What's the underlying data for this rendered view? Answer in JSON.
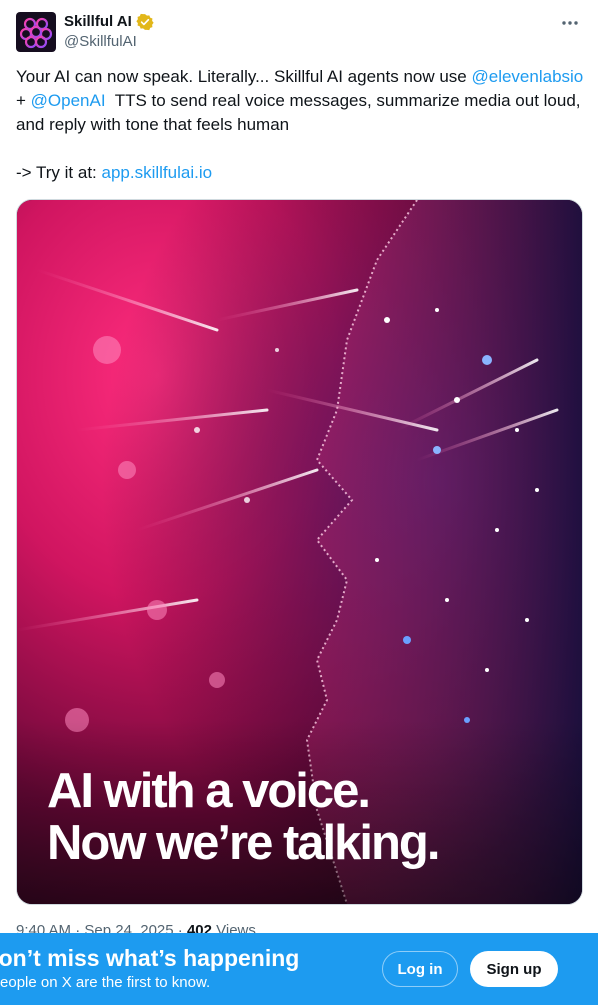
{
  "author": {
    "display_name": "Skillful AI",
    "handle": "@SkillfulAI",
    "verified": true
  },
  "tweet": {
    "text_part1": "Your AI can now speak. Literally... Skillful AI agents now use ",
    "mention1": "@elevenlabsio",
    "text_part2": "  + ",
    "mention2": "@OpenAI",
    "text_part3": "  TTS to send real voice messages, summarize media out loud, and reply with tone that feels human\n\n-> Try it at: ",
    "link": "app.skillfulai.io"
  },
  "media": {
    "caption": "AI with a voice.\nNow we’re talking."
  },
  "meta": {
    "time_date": "9:40 AM · Sep 24, 2025 · ",
    "views_count": "402",
    "views_label": " Views"
  },
  "banner": {
    "title": "Don’t miss what’s happening",
    "subtitle": "People on X are the first to know.",
    "login_label": "Log in",
    "signup_label": "Sign up"
  },
  "colors": {
    "accent": "#1d9bf0",
    "verified_badge": "#e2b719",
    "text_primary": "#0f1419",
    "text_secondary": "#536471"
  },
  "icons": [
    "skillful-ai-logo-icon",
    "verified-badge-icon",
    "more-options-icon"
  ]
}
